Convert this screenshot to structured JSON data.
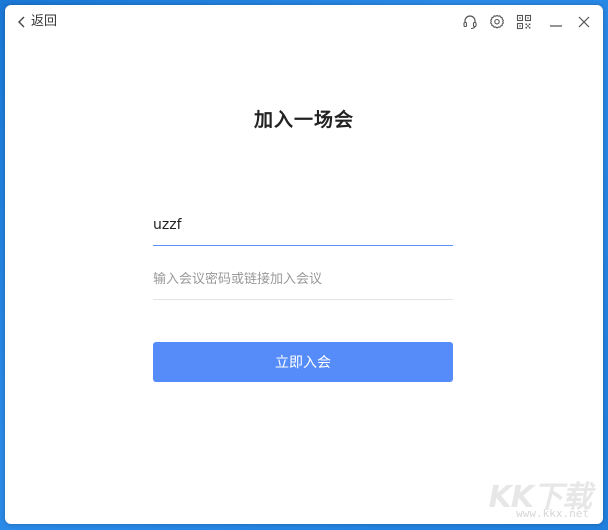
{
  "titlebar": {
    "back_label": "返回",
    "icons": [
      "headset-icon",
      "gear-icon",
      "qr-code-icon",
      "minimize-icon",
      "close-icon"
    ]
  },
  "main": {
    "heading": "加入一场会",
    "name_field": {
      "value": "uzzf"
    },
    "password_field": {
      "placeholder": "输入会议密码或链接加入会议",
      "value": ""
    },
    "join_button_label": "立即入会"
  },
  "watermark": {
    "logo_text": "KK下载",
    "url": "www.kkx.net"
  },
  "colors": {
    "accent": "#558cf9",
    "active_underline": "#5b8ff9",
    "background": "#1f7fdc"
  }
}
